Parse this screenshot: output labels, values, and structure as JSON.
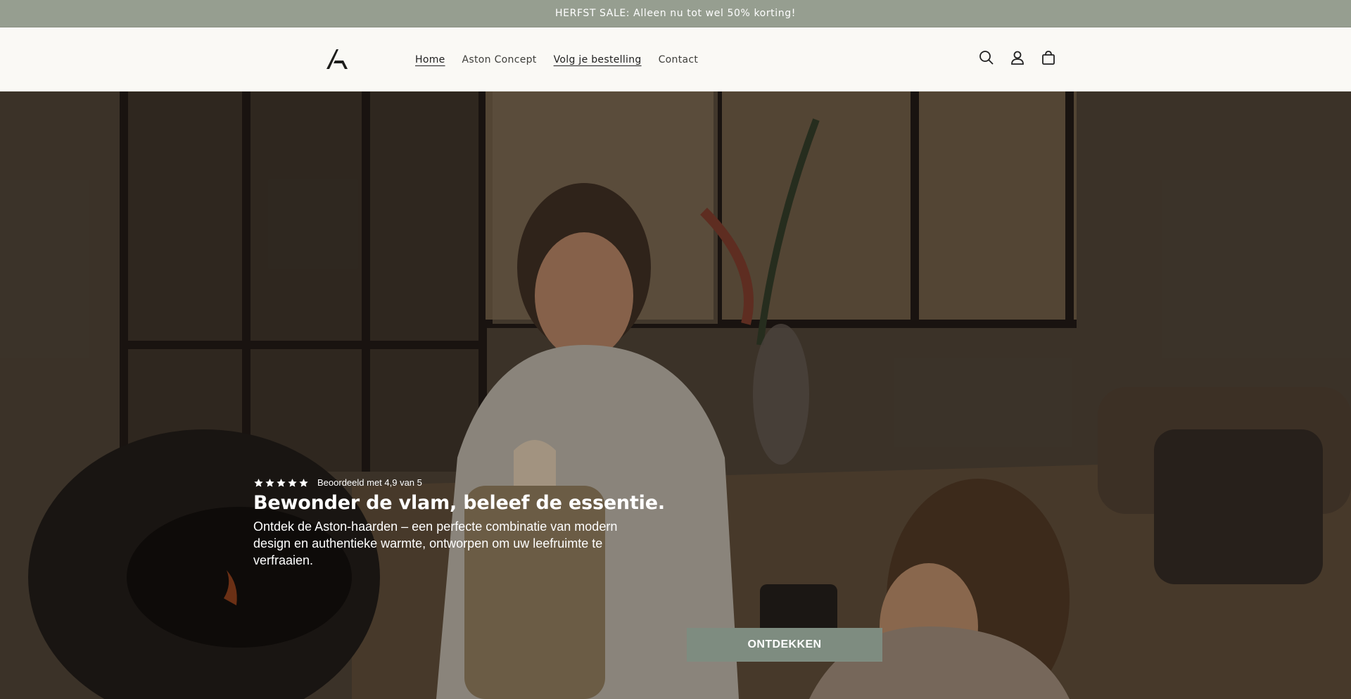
{
  "announcement": {
    "text": "HERFST SALE: Alleen nu tot wel 50% korting!"
  },
  "header": {
    "logo": "aston-logo",
    "nav": [
      {
        "label": "Home",
        "underlined": true
      },
      {
        "label": "Aston Concept",
        "underlined": false
      },
      {
        "label": "Volg je bestelling",
        "underlined": true
      },
      {
        "label": "Contact",
        "underlined": false
      }
    ],
    "icons": [
      "search-icon",
      "account-icon",
      "cart-icon"
    ]
  },
  "hero": {
    "rating_stars": 5,
    "rating_text": "Beoordeeld met 4,9 van 5",
    "title": "Bewonder de vlam, beleef de essentie.",
    "subtitle": "Ontdek de Aston-haarden – een perfecte combinatie van modern design en authentieke warmte, ontworpen om uw leefruimte te verfraaien.",
    "cta_label": "ONTDEKKEN"
  },
  "colors": {
    "announcement_bg": "#969e90",
    "header_bg": "#faf9f5",
    "cta_bg": "#7e8c80"
  }
}
